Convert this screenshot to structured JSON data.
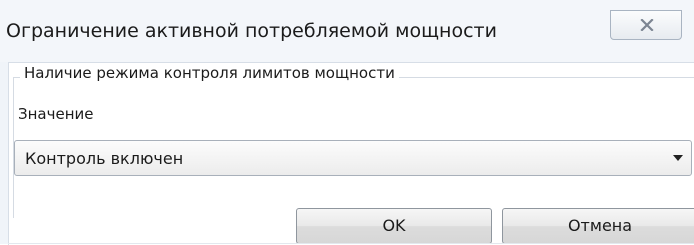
{
  "window": {
    "title": "Ограничение активной потребляемой мощности"
  },
  "group": {
    "label": "Наличие режима контроля лимитов мощности"
  },
  "field": {
    "label": "Значение",
    "selected_value": "Контроль включен"
  },
  "buttons": {
    "ok_label": "OK",
    "cancel_label": "Отмена"
  },
  "icons": {
    "close": "close-icon",
    "dropdown": "chevron-down-icon"
  },
  "colors": {
    "window_bg": "#f0f4f9",
    "content_bg": "#ffffff",
    "text": "#1b1b1b"
  }
}
